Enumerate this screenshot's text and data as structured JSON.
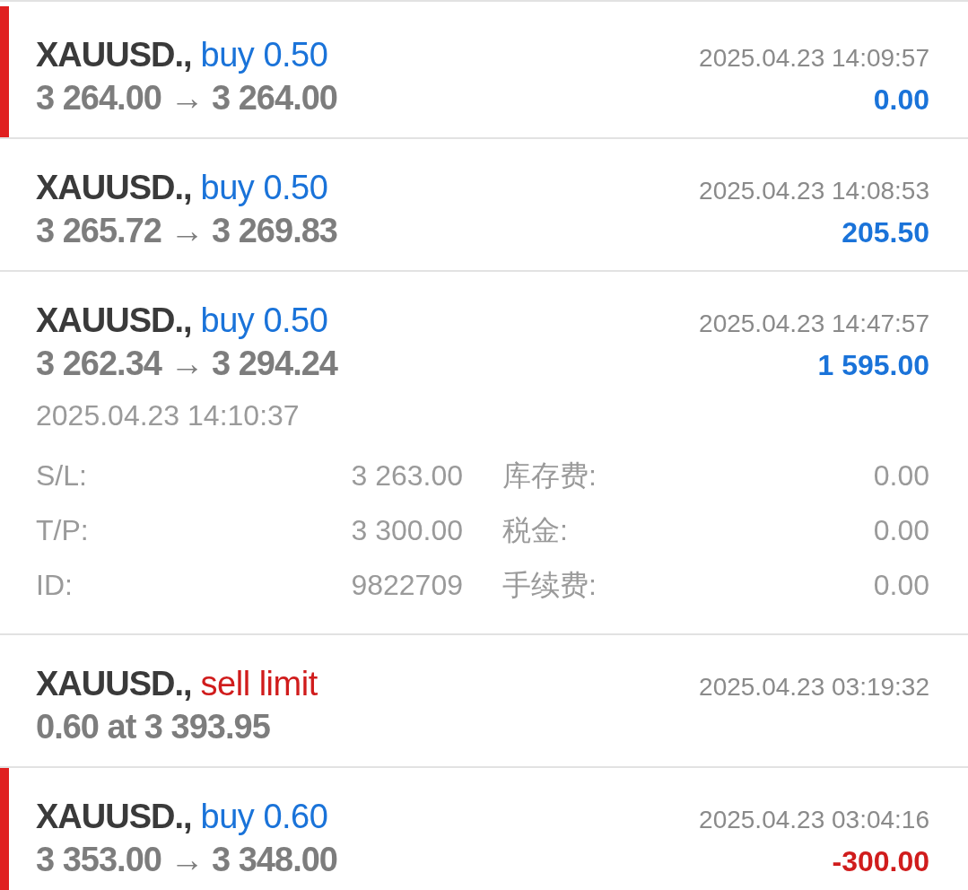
{
  "orders": [
    {
      "symbol": "XAUUSD.,",
      "type": "buy 0.50",
      "kind": "buy",
      "prices": "3 264.00 → 3 264.00",
      "time": "2025.04.23 14:09:57",
      "profit": "0.00",
      "loss": false,
      "flagged": true
    },
    {
      "symbol": "XAUUSD.,",
      "type": "buy 0.50",
      "kind": "buy",
      "prices": "3 265.72 → 3 269.83",
      "time": "2025.04.23 14:08:53",
      "profit": "205.50",
      "loss": false,
      "flagged": false
    },
    {
      "symbol": "XAUUSD.,",
      "type": "buy 0.50",
      "kind": "buy",
      "prices": "3 262.34 → 3 294.24",
      "time": "2025.04.23 14:47:57",
      "profit": "1 595.00",
      "loss": false,
      "flagged": false,
      "details": {
        "open_time": "2025.04.23 14:10:37",
        "rows": [
          {
            "label": "S/L:",
            "value": "3 263.00",
            "label_2": "库存费:",
            "value_2": "0.00"
          },
          {
            "label": "T/P:",
            "value": "3 300.00",
            "label_2": "税金:",
            "value_2": "0.00"
          },
          {
            "label": "ID:",
            "value": "9822709",
            "label_2": "手续费:",
            "value_2": "0.00"
          }
        ]
      }
    },
    {
      "symbol": "XAUUSD.,",
      "type": "sell limit",
      "kind": "sell",
      "prices": "0.60 at 3 393.95",
      "time": "2025.04.23 03:19:32",
      "flagged": false
    },
    {
      "symbol": "XAUUSD.,",
      "type": "buy 0.60",
      "kind": "buy",
      "prices": "3 353.00 → 3 348.00",
      "time": "2025.04.23 03:04:16",
      "profit": "-300.00",
      "loss": true,
      "flagged": true
    }
  ]
}
